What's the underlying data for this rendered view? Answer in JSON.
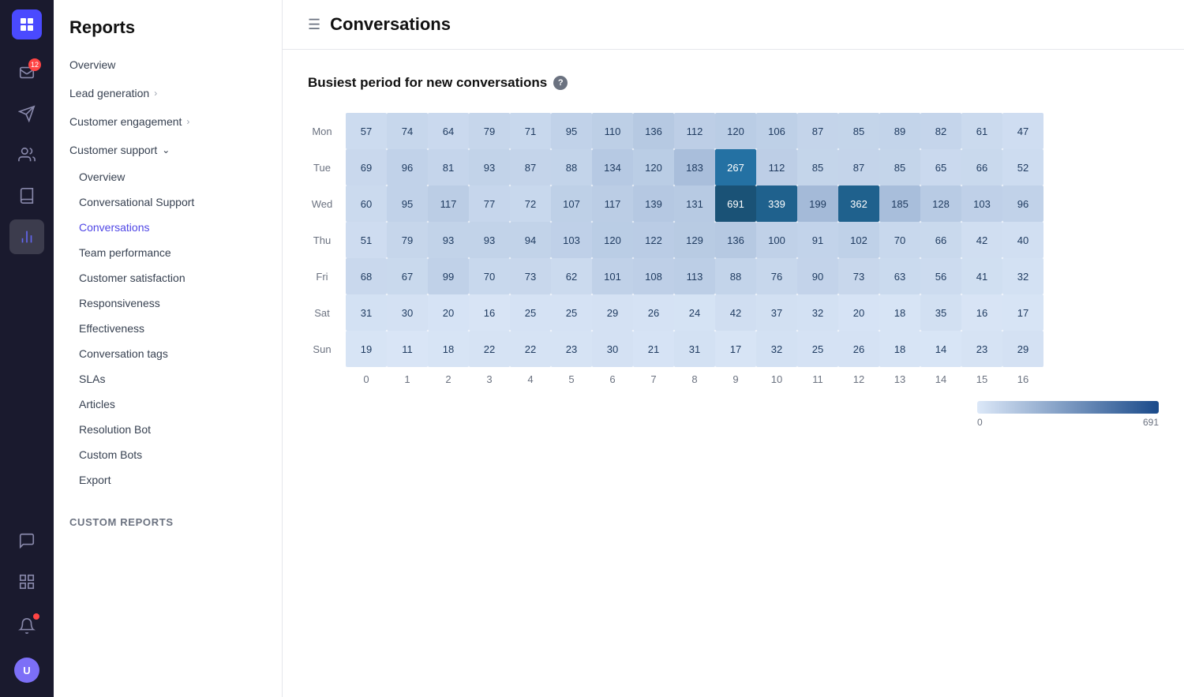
{
  "app": {
    "title": "Reports",
    "page_title": "Conversations",
    "section_heading": "Busiest period for new conversations"
  },
  "rail": {
    "badge_count": "12",
    "icons": [
      {
        "name": "inbox-icon",
        "label": "Inbox",
        "has_badge": true,
        "active": false
      },
      {
        "name": "send-icon",
        "label": "Send",
        "has_badge": false,
        "active": false
      },
      {
        "name": "contacts-icon",
        "label": "Contacts",
        "has_badge": false,
        "active": false
      },
      {
        "name": "knowledge-icon",
        "label": "Knowledge",
        "has_badge": false,
        "active": false
      },
      {
        "name": "reports-icon",
        "label": "Reports",
        "has_badge": false,
        "active": true
      },
      {
        "name": "chat-icon",
        "label": "Chat",
        "has_badge": false,
        "active": false
      },
      {
        "name": "apps-icon",
        "label": "Apps",
        "has_badge": false,
        "active": false
      }
    ]
  },
  "sidebar": {
    "header": "Reports",
    "items": [
      {
        "id": "overview-top",
        "label": "Overview",
        "level": "top",
        "active": false
      },
      {
        "id": "lead-generation",
        "label": "Lead generation",
        "level": "top",
        "has_chevron": true,
        "active": false
      },
      {
        "id": "customer-engagement",
        "label": "Customer engagement",
        "level": "top",
        "has_chevron": true,
        "active": false
      },
      {
        "id": "customer-support",
        "label": "Customer support",
        "level": "top",
        "has_chevron": true,
        "expanded": true,
        "active": false
      },
      {
        "id": "overview-sub",
        "label": "Overview",
        "level": "sub",
        "active": false
      },
      {
        "id": "conversational-support",
        "label": "Conversational Support",
        "level": "sub",
        "active": false
      },
      {
        "id": "conversations",
        "label": "Conversations",
        "level": "sub",
        "active": true
      },
      {
        "id": "team-performance",
        "label": "Team performance",
        "level": "sub",
        "active": false
      },
      {
        "id": "customer-satisfaction",
        "label": "Customer satisfaction",
        "level": "sub",
        "active": false
      },
      {
        "id": "responsiveness",
        "label": "Responsiveness",
        "level": "sub",
        "active": false
      },
      {
        "id": "effectiveness",
        "label": "Effectiveness",
        "level": "sub",
        "active": false
      },
      {
        "id": "conversation-tags",
        "label": "Conversation tags",
        "level": "sub",
        "active": false
      },
      {
        "id": "slas",
        "label": "SLAs",
        "level": "sub",
        "active": false
      },
      {
        "id": "articles",
        "label": "Articles",
        "level": "sub",
        "active": false
      },
      {
        "id": "resolution-bot",
        "label": "Resolution Bot",
        "level": "sub",
        "active": false
      },
      {
        "id": "custom-bots",
        "label": "Custom Bots",
        "level": "sub",
        "active": false
      },
      {
        "id": "export",
        "label": "Export",
        "level": "sub",
        "active": false
      }
    ],
    "custom_reports_label": "Custom reports"
  },
  "heatmap": {
    "days": [
      "Mon",
      "Tue",
      "Wed",
      "Thu",
      "Fri",
      "Sat",
      "Sun"
    ],
    "hours": [
      "0",
      "1",
      "2",
      "3",
      "4",
      "5",
      "6",
      "7",
      "8",
      "9",
      "10",
      "11",
      "12",
      "13",
      "14",
      "15",
      "16"
    ],
    "max_value": 691,
    "data": {
      "Mon": [
        57,
        74,
        64,
        79,
        71,
        95,
        110,
        136,
        112,
        120,
        106,
        87,
        85,
        89,
        82,
        61,
        47
      ],
      "Tue": [
        69,
        96,
        81,
        93,
        87,
        88,
        134,
        120,
        183,
        267,
        112,
        85,
        87,
        85,
        65,
        66,
        52
      ],
      "Wed": [
        60,
        95,
        117,
        77,
        72,
        107,
        117,
        139,
        131,
        691,
        339,
        199,
        362,
        185,
        128,
        103,
        96
      ],
      "Thu": [
        51,
        79,
        93,
        93,
        94,
        103,
        120,
        122,
        129,
        136,
        100,
        91,
        102,
        70,
        66,
        42,
        40
      ],
      "Fri": [
        68,
        67,
        99,
        70,
        73,
        62,
        101,
        108,
        113,
        88,
        76,
        90,
        73,
        63,
        56,
        41,
        32
      ],
      "Sat": [
        31,
        30,
        20,
        16,
        25,
        25,
        29,
        26,
        24,
        42,
        37,
        32,
        20,
        18,
        35,
        16,
        17
      ],
      "Sun": [
        19,
        11,
        18,
        22,
        22,
        23,
        30,
        21,
        31,
        17,
        32,
        25,
        26,
        18,
        14,
        23,
        29
      ]
    },
    "legend_min": "0",
    "legend_max": "691"
  }
}
